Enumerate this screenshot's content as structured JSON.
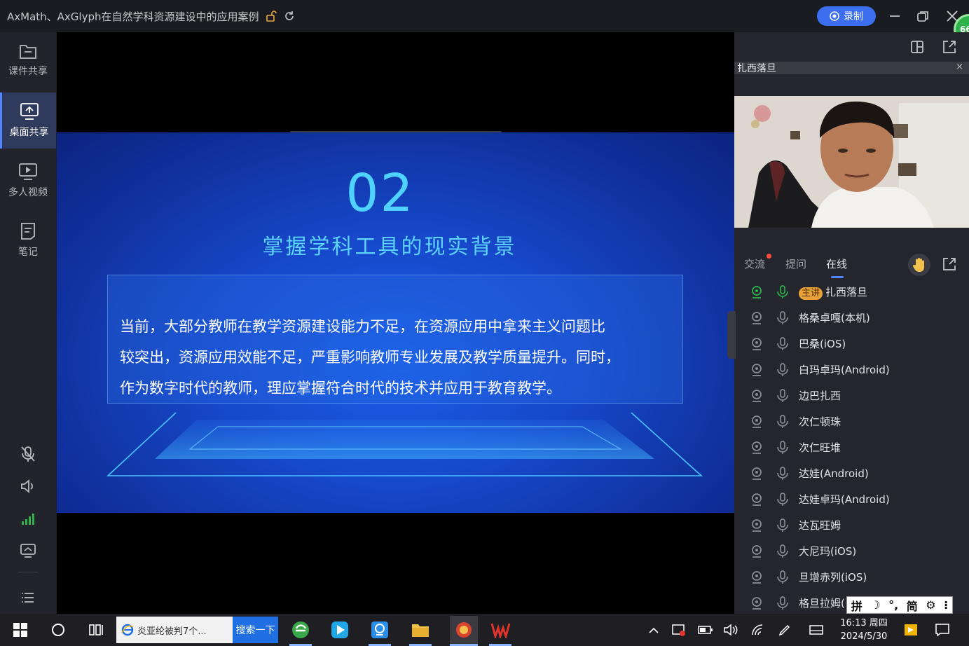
{
  "window": {
    "title": "AxMath、AxGlyph在自然学科资源建设中的应用案例",
    "record_label": "录制",
    "badge_count": "66"
  },
  "sidebar": {
    "items": [
      {
        "label": "课件共享",
        "icon": "folder-icon"
      },
      {
        "label": "桌面共享",
        "icon": "screen-share-icon",
        "active": true
      },
      {
        "label": "多人视频",
        "icon": "video-play-icon"
      },
      {
        "label": "笔记",
        "icon": "note-icon"
      }
    ],
    "tools": [
      "mic-off-icon",
      "speaker-icon",
      "signal-icon",
      "screen-icon",
      "menu-icon"
    ]
  },
  "slide": {
    "number": "02",
    "heading": "掌握学科工具的现实背景",
    "lines": [
      "当前，大部分教师在教学资源建设能力不足，在资源应用中拿来主义问题比",
      "较突出，资源应用效能不足，严重影响教师专业发展及教学质量提升。同时，",
      "作为数字时代的教师，理应掌握符合时代的技术并应用于教育教学。"
    ]
  },
  "video_panel": {
    "speaker_name": "扎西落旦",
    "close": "×"
  },
  "tabs": [
    {
      "label": "交流",
      "has_dot": true
    },
    {
      "label": "提问"
    },
    {
      "label": "在线",
      "active": true
    }
  ],
  "users": [
    {
      "tag": "主讲",
      "name": "扎西落旦",
      "active": true
    },
    {
      "name": "格桑卓嘎(本机)"
    },
    {
      "name": "巴桑(iOS)"
    },
    {
      "name": "白玛卓玛(Android)"
    },
    {
      "name": "边巴扎西"
    },
    {
      "name": "次仁顿珠"
    },
    {
      "name": "次仁旺堆"
    },
    {
      "name": "达娃(Android)"
    },
    {
      "name": "达娃卓玛(Android)"
    },
    {
      "name": "达瓦旺姆"
    },
    {
      "name": "大尼玛(iOS)"
    },
    {
      "name": "旦增赤列(iOS)"
    },
    {
      "name": "格旦拉姆("
    }
  ],
  "ime": [
    "拼",
    "简"
  ],
  "taskbar": {
    "search_text": "炎亚纶被判7个...",
    "search_button": "搜索一下",
    "time": "16:13 周四",
    "date": "2024/5/30"
  },
  "colors": {
    "accent": "#3b6ff0",
    "slide_title": "#4fd2ff",
    "online_green": "#2fb24c",
    "host_tag": "#e8a23a"
  }
}
